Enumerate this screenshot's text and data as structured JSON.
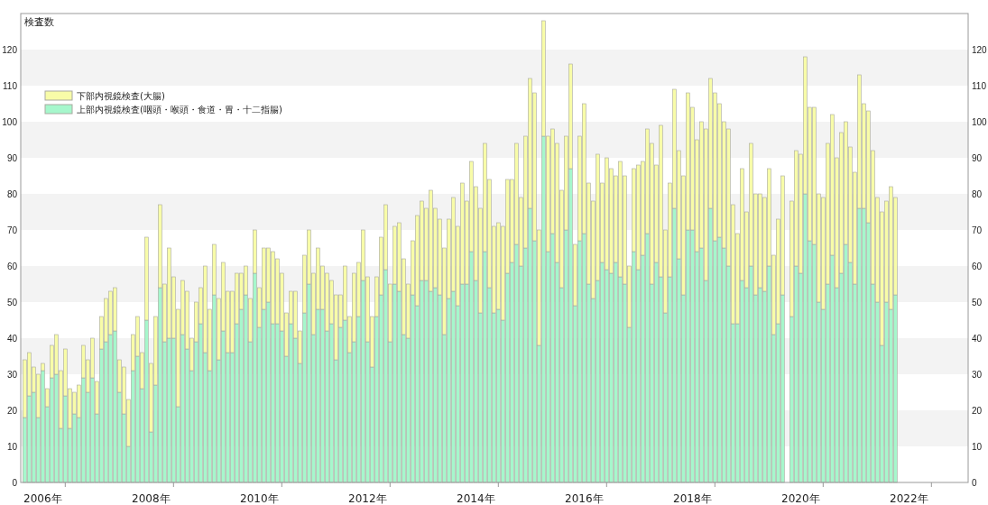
{
  "chart": {
    "chart_data": {
      "type": "bar",
      "stacked": true,
      "legend": "upper left",
      "ylabel": "検査数",
      "ylim": [
        0,
        130
      ],
      "yticks": [
        0,
        10,
        20,
        30,
        40,
        50,
        60,
        70,
        80,
        90,
        100,
        110,
        120
      ],
      "categories": [
        null,
        null,
        null,
        null,
        "2006年",
        null,
        null,
        null,
        null,
        null,
        null,
        null,
        null,
        null,
        null,
        null,
        null,
        null,
        null,
        null,
        null,
        null,
        null,
        null,
        null,
        null,
        null,
        null,
        "2008年",
        null,
        null,
        null,
        null,
        null,
        null,
        null,
        null,
        null,
        null,
        null,
        null,
        null,
        null,
        null,
        null,
        null,
        null,
        null,
        null,
        null,
        null,
        null,
        "2010年",
        null,
        null,
        null,
        null,
        null,
        null,
        null,
        null,
        null,
        null,
        null,
        null,
        null,
        null,
        null,
        null,
        null,
        null,
        null,
        null,
        null,
        null,
        null,
        "2012年",
        null,
        null,
        null,
        null,
        null,
        null,
        null,
        null,
        null,
        null,
        null,
        null,
        null,
        null,
        null,
        null,
        null,
        null,
        null,
        null,
        null,
        null,
        null,
        "2014年",
        null,
        null,
        null,
        null,
        null,
        null,
        null,
        null,
        null,
        null,
        null,
        null,
        null,
        null,
        null,
        null,
        null,
        null,
        null,
        null,
        null,
        null,
        null,
        "2016年",
        null,
        null,
        null,
        null,
        null,
        null,
        null,
        null,
        null,
        null,
        null,
        null,
        null,
        null,
        null,
        null,
        null,
        null,
        null,
        null,
        null,
        null,
        null,
        "2018年",
        null,
        null,
        null,
        null,
        null,
        null,
        null,
        null,
        null,
        null,
        null,
        null,
        null,
        null,
        null,
        null,
        null,
        null,
        null,
        null,
        null,
        null,
        null,
        "2020年",
        null,
        null,
        null,
        null,
        null,
        null,
        null,
        null,
        null,
        null,
        null,
        null,
        null,
        null,
        null,
        null,
        null,
        null,
        null,
        null,
        null,
        null,
        null,
        "2022年"
      ],
      "series": [
        {
          "name": "下部内視鏡検査(大腸)",
          "color": "#f8fca8",
          "values": [
            16,
            12,
            7,
            12,
            2,
            5,
            9,
            11,
            16,
            13,
            11,
            6,
            9,
            9,
            9,
            11,
            9,
            9,
            12,
            12,
            12,
            9,
            13,
            13,
            10,
            11,
            10,
            23,
            19,
            19,
            23,
            16,
            25,
            17,
            27,
            15,
            16,
            9,
            11,
            10,
            24,
            17,
            14,
            17,
            19,
            17,
            17,
            14,
            10,
            8,
            12,
            12,
            11,
            17,
            15,
            20,
            18,
            16,
            12,
            9,
            13,
            9,
            16,
            15,
            17,
            17,
            12,
            16,
            12,
            18,
            9,
            15,
            10,
            19,
            15,
            14,
            18,
            14,
            11,
            16,
            18,
            16,
            16,
            19,
            21,
            15,
            15,
            25,
            22,
            20,
            28,
            22,
            21,
            24,
            22,
            26,
            22,
            28,
            23,
            25,
            26,
            29,
            30,
            30,
            24,
            24,
            26,
            26,
            23,
            28,
            19,
            31,
            36,
            41,
            32,
            32,
            32,
            29,
            33,
            27,
            26,
            29,
            17,
            29,
            36,
            28,
            27,
            35,
            22,
            31,
            29,
            24,
            32,
            30,
            17,
            23,
            29,
            26,
            29,
            39,
            27,
            42,
            23,
            26,
            33,
            30,
            33,
            38,
            34,
            31,
            35,
            42,
            36,
            41,
            37,
            35,
            38,
            33,
            25,
            31,
            21,
            34,
            28,
            26,
            26,
            27,
            22,
            29,
            33,
            null,
            32,
            32,
            33,
            38,
            37,
            38,
            30,
            31,
            39,
            39,
            36,
            39,
            34,
            32,
            31,
            37,
            29,
            31,
            37,
            29,
            37,
            28,
            34,
            27,
            null,
            null,
            null
          ]
        },
        {
          "name": "上部内視鏡検査(咽頭・喉頭・食道・胃・十二指腸)",
          "color": "#a6f7cc",
          "values": [
            18,
            24,
            25,
            18,
            31,
            21,
            29,
            30,
            15,
            24,
            15,
            19,
            18,
            29,
            25,
            29,
            19,
            37,
            39,
            41,
            42,
            25,
            19,
            10,
            31,
            35,
            26,
            45,
            14,
            27,
            54,
            39,
            40,
            40,
            21,
            41,
            37,
            31,
            39,
            44,
            36,
            31,
            52,
            34,
            42,
            36,
            36,
            44,
            48,
            52,
            39,
            58,
            43,
            48,
            50,
            44,
            44,
            42,
            35,
            44,
            40,
            33,
            47,
            55,
            41,
            48,
            48,
            42,
            44,
            34,
            43,
            45,
            36,
            39,
            46,
            56,
            39,
            32,
            46,
            52,
            59,
            39,
            55,
            53,
            41,
            40,
            52,
            49,
            56,
            56,
            53,
            54,
            52,
            41,
            51,
            53,
            49,
            55,
            55,
            64,
            56,
            47,
            64,
            54,
            47,
            48,
            45,
            58,
            61,
            66,
            60,
            65,
            76,
            67,
            38,
            96,
            64,
            69,
            61,
            54,
            70,
            87,
            49,
            67,
            69,
            55,
            51,
            56,
            61,
            59,
            58,
            61,
            57,
            55,
            43,
            64,
            59,
            63,
            69,
            55,
            61,
            57,
            47,
            57,
            76,
            62,
            52,
            70,
            70,
            64,
            65,
            56,
            76,
            67,
            68,
            65,
            60,
            44,
            44,
            56,
            54,
            60,
            52,
            54,
            53,
            60,
            41,
            44,
            52,
            null,
            46,
            60,
            58,
            80,
            67,
            66,
            50,
            48,
            55,
            63,
            54,
            58,
            66,
            61,
            55,
            76,
            76,
            72,
            55,
            50,
            38,
            50,
            48,
            52,
            null,
            null,
            null
          ]
        }
      ]
    },
    "right_axis_ticks": [
      "120",
      "110",
      "100",
      "90",
      "80",
      "70",
      "60",
      "50",
      "40",
      "30",
      "20",
      "10",
      "0"
    ]
  }
}
